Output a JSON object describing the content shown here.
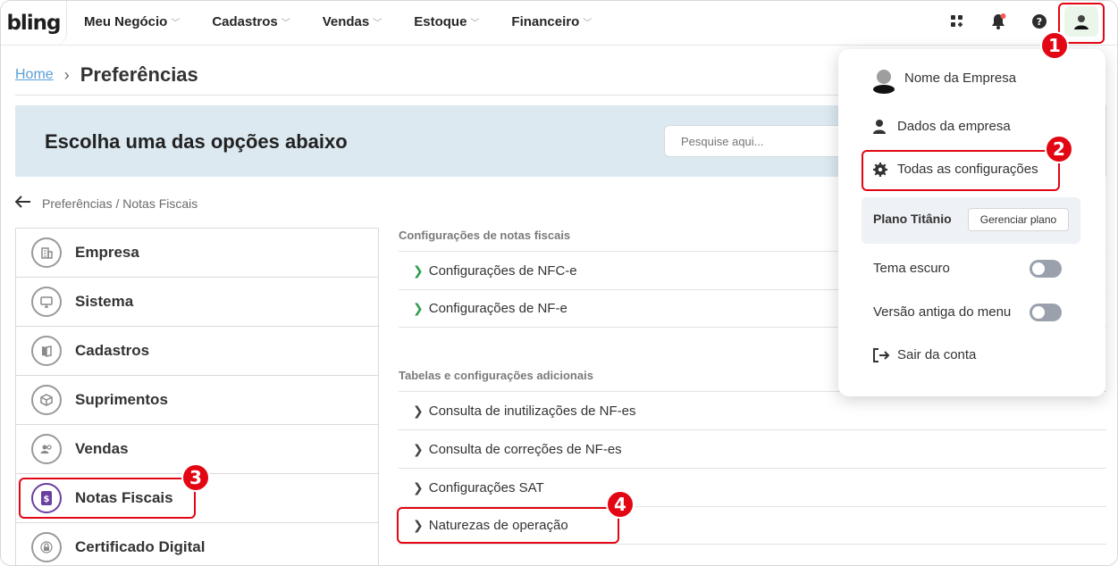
{
  "header": {
    "logo": "bling",
    "nav": [
      "Meu Negócio",
      "Cadastros",
      "Vendas",
      "Estoque",
      "Financeiro"
    ]
  },
  "breadcrumb": {
    "home": "Home",
    "separator": "›",
    "title": "Preferências"
  },
  "banner": {
    "title": "Escolha uma das opções abaixo",
    "search_placeholder": "Pesquise aqui..."
  },
  "back": {
    "path": "Preferências / Notas Fiscais"
  },
  "menu": [
    {
      "label": "Empresa",
      "icon": "building-icon"
    },
    {
      "label": "Sistema",
      "icon": "monitor-icon"
    },
    {
      "label": "Cadastros",
      "icon": "book-icon"
    },
    {
      "label": "Suprimentos",
      "icon": "box-icon"
    },
    {
      "label": "Vendas",
      "icon": "people-icon"
    },
    {
      "label": "Notas Fiscais",
      "icon": "receipt-icon"
    },
    {
      "label": "Certificado Digital",
      "icon": "lock-icon"
    }
  ],
  "sections": {
    "notas": {
      "title": "Configurações de notas fiscais",
      "items": [
        "Configurações de NFC-e",
        "Configurações de NF-e"
      ]
    },
    "tabelas": {
      "title": "Tabelas e configurações adicionais",
      "items": [
        "Consulta de inutilizações de NF-es",
        "Consulta de correções de NF-es",
        "Configurações SAT",
        "Naturezas de operação"
      ]
    }
  },
  "dropdown": {
    "company_name": "Nome da Empresa",
    "company_data": "Dados da empresa",
    "all_settings": "Todas as configurações",
    "plan_label": "Plano Titânio",
    "plan_button": "Gerenciar plano",
    "dark_theme": "Tema escuro",
    "old_menu": "Versão antiga do menu",
    "logout": "Sair da conta"
  },
  "annotations": [
    "1",
    "2",
    "3",
    "4"
  ],
  "colors": {
    "highlight": "#e30613",
    "banner": "#dce9f1",
    "link": "#5b9ed6",
    "chevron_green": "#2e9e4b",
    "active_icon": "#6b3fa0"
  }
}
